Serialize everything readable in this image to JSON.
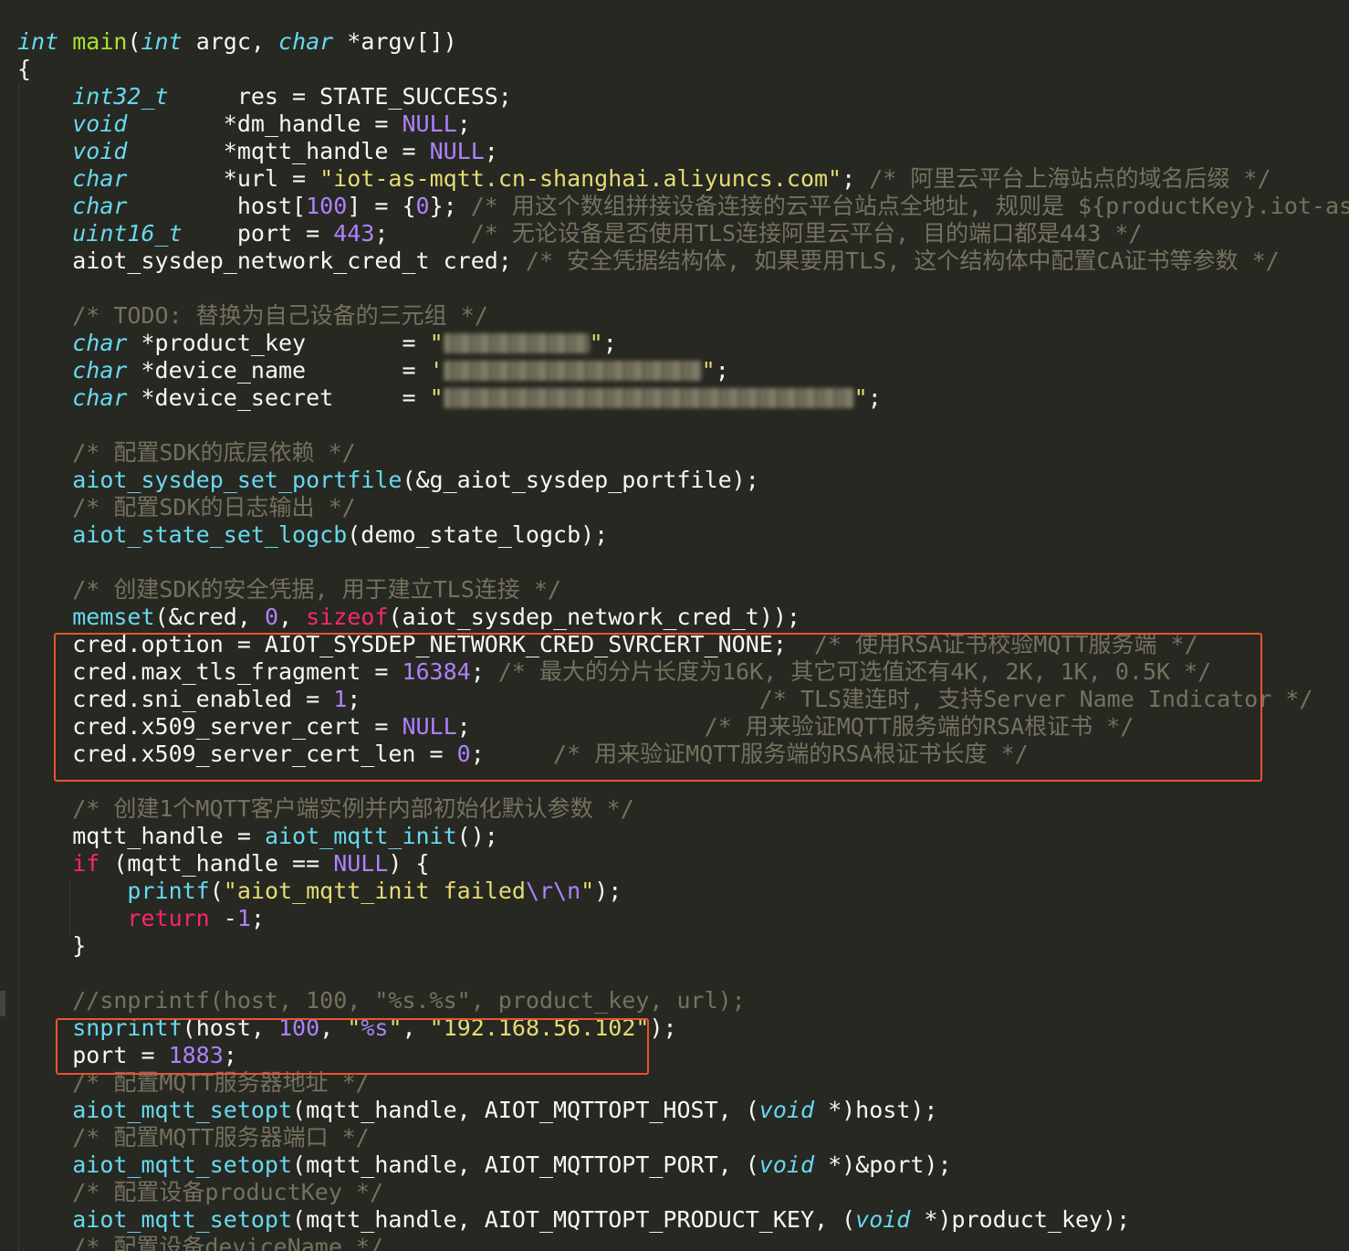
{
  "editor": {
    "colors": {
      "background": "#272822",
      "text": "#f8f8f2",
      "type": "#66d9ef",
      "function": "#a6e22e",
      "keyword": "#f92672",
      "number": "#ae81ff",
      "string": "#e6db74",
      "comment": "#75715e",
      "highlight_box": "#e8542f"
    },
    "lines": [
      [
        {
          "t": "int",
          "c": "type"
        },
        {
          "t": " ",
          "c": "plain"
        },
        {
          "t": "main",
          "c": "defn"
        },
        {
          "t": "(",
          "c": "plain"
        },
        {
          "t": "int",
          "c": "type"
        },
        {
          "t": " argc, ",
          "c": "plain"
        },
        {
          "t": "char",
          "c": "type"
        },
        {
          "t": " *argv[])",
          "c": "plain"
        }
      ],
      [
        {
          "t": "{",
          "c": "plain"
        }
      ],
      [
        {
          "t": "    ",
          "c": "plain"
        },
        {
          "t": "int32_t",
          "c": "type"
        },
        {
          "t": "     res = STATE_SUCCESS;",
          "c": "plain"
        }
      ],
      [
        {
          "t": "    ",
          "c": "plain"
        },
        {
          "t": "void",
          "c": "type"
        },
        {
          "t": "       *dm_handle = ",
          "c": "plain"
        },
        {
          "t": "NULL",
          "c": "const"
        },
        {
          "t": ";",
          "c": "plain"
        }
      ],
      [
        {
          "t": "    ",
          "c": "plain"
        },
        {
          "t": "void",
          "c": "type"
        },
        {
          "t": "       *mqtt_handle = ",
          "c": "plain"
        },
        {
          "t": "NULL",
          "c": "const"
        },
        {
          "t": ";",
          "c": "plain"
        }
      ],
      [
        {
          "t": "    ",
          "c": "plain"
        },
        {
          "t": "char",
          "c": "type"
        },
        {
          "t": "       *url = ",
          "c": "plain"
        },
        {
          "t": "\"iot-as-mqtt.cn-shanghai.aliyuncs.com\"",
          "c": "str"
        },
        {
          "t": "; ",
          "c": "plain"
        },
        {
          "t": "/* 阿里云平台上海站点的域名后缀 */",
          "c": "comment"
        }
      ],
      [
        {
          "t": "    ",
          "c": "plain"
        },
        {
          "t": "char",
          "c": "type"
        },
        {
          "t": "        host[",
          "c": "plain"
        },
        {
          "t": "100",
          "c": "num"
        },
        {
          "t": "] = {",
          "c": "plain"
        },
        {
          "t": "0",
          "c": "num"
        },
        {
          "t": "}; ",
          "c": "plain"
        },
        {
          "t": "/* 用这个数组拼接设备连接的云平台站点全地址, 规则是 ${productKey}.iot-as-mqtt.",
          "c": "comment"
        }
      ],
      [
        {
          "t": "    ",
          "c": "plain"
        },
        {
          "t": "uint16_t",
          "c": "type"
        },
        {
          "t": "    port = ",
          "c": "plain"
        },
        {
          "t": "443",
          "c": "num"
        },
        {
          "t": ";      ",
          "c": "plain"
        },
        {
          "t": "/* 无论设备是否使用TLS连接阿里云平台, 目的端口都是443 */",
          "c": "comment"
        }
      ],
      [
        {
          "t": "    aiot_sysdep_network_cred_t cred; ",
          "c": "plain"
        },
        {
          "t": "/* 安全凭据结构体, 如果要用TLS, 这个结构体中配置CA证书等参数 */",
          "c": "comment"
        }
      ],
      [],
      [
        {
          "t": "    ",
          "c": "plain"
        },
        {
          "t": "/* TODO: 替换为自己设备的三元组 */",
          "c": "comment"
        }
      ],
      [
        {
          "t": "    ",
          "c": "plain"
        },
        {
          "t": "char",
          "c": "type"
        },
        {
          "t": " *product_key       = ",
          "c": "plain"
        },
        {
          "t": "\"",
          "c": "str"
        },
        {
          "t": "",
          "c": "redacted",
          "w": 160
        },
        {
          "t": "\"",
          "c": "str"
        },
        {
          "t": ";",
          "c": "plain"
        }
      ],
      [
        {
          "t": "    ",
          "c": "plain"
        },
        {
          "t": "char",
          "c": "type"
        },
        {
          "t": " *device_name       = ",
          "c": "plain"
        },
        {
          "t": "'",
          "c": "str"
        },
        {
          "t": "",
          "c": "redacted",
          "w": 283
        },
        {
          "t": "\"",
          "c": "str"
        },
        {
          "t": ";",
          "c": "plain"
        }
      ],
      [
        {
          "t": "    ",
          "c": "plain"
        },
        {
          "t": "char",
          "c": "type"
        },
        {
          "t": " *device_secret     = ",
          "c": "plain"
        },
        {
          "t": "\"",
          "c": "str"
        },
        {
          "t": "",
          "c": "redacted",
          "w": 450
        },
        {
          "t": "\"",
          "c": "str"
        },
        {
          "t": ";",
          "c": "plain"
        }
      ],
      [],
      [
        {
          "t": "    ",
          "c": "plain"
        },
        {
          "t": "/* 配置SDK的底层依赖 */",
          "c": "comment"
        }
      ],
      [
        {
          "t": "    ",
          "c": "plain"
        },
        {
          "t": "aiot_sysdep_set_portfile",
          "c": "func"
        },
        {
          "t": "(&g_aiot_sysdep_portfile);",
          "c": "plain"
        }
      ],
      [
        {
          "t": "    ",
          "c": "plain"
        },
        {
          "t": "/* 配置SDK的日志输出 */",
          "c": "comment"
        }
      ],
      [
        {
          "t": "    ",
          "c": "plain"
        },
        {
          "t": "aiot_state_set_logcb",
          "c": "func"
        },
        {
          "t": "(demo_state_logcb);",
          "c": "plain"
        }
      ],
      [],
      [
        {
          "t": "    ",
          "c": "plain"
        },
        {
          "t": "/* 创建SDK的安全凭据, 用于建立TLS连接 */",
          "c": "comment"
        }
      ],
      [
        {
          "t": "    ",
          "c": "plain"
        },
        {
          "t": "memset",
          "c": "func"
        },
        {
          "t": "(&cred, ",
          "c": "plain"
        },
        {
          "t": "0",
          "c": "num"
        },
        {
          "t": ", ",
          "c": "plain"
        },
        {
          "t": "sizeof",
          "c": "kw"
        },
        {
          "t": "(aiot_sysdep_network_cred_t));",
          "c": "plain"
        }
      ],
      [
        {
          "t": "    cred.option = AIOT_SYSDEP_NETWORK_CRED_SVRCERT_NONE;  ",
          "c": "plain"
        },
        {
          "t": "/* 使用RSA证书校验MQTT服务端 */",
          "c": "comment"
        }
      ],
      [
        {
          "t": "    cred.max_tls_fragment = ",
          "c": "plain"
        },
        {
          "t": "16384",
          "c": "num"
        },
        {
          "t": "; ",
          "c": "plain"
        },
        {
          "t": "/* 最大的分片长度为16K, 其它可选值还有4K, 2K, 1K, 0.5K */",
          "c": "comment"
        }
      ],
      [
        {
          "t": "    cred.sni_enabled = ",
          "c": "plain"
        },
        {
          "t": "1",
          "c": "num"
        },
        {
          "t": ";                             ",
          "c": "plain"
        },
        {
          "t": "/* TLS建连时, 支持Server Name Indicator */",
          "c": "comment"
        }
      ],
      [
        {
          "t": "    cred.x509_server_cert = ",
          "c": "plain"
        },
        {
          "t": "NULL",
          "c": "const"
        },
        {
          "t": ";                 ",
          "c": "plain"
        },
        {
          "t": "/* 用来验证MQTT服务端的RSA根证书 */",
          "c": "comment"
        }
      ],
      [
        {
          "t": "    cred.x509_server_cert_len = ",
          "c": "plain"
        },
        {
          "t": "0",
          "c": "num"
        },
        {
          "t": ";     ",
          "c": "plain"
        },
        {
          "t": "/* 用来验证MQTT服务端的RSA根证书长度 */",
          "c": "comment"
        }
      ],
      [],
      [
        {
          "t": "    ",
          "c": "plain"
        },
        {
          "t": "/* 创建1个MQTT客户端实例并内部初始化默认参数 */",
          "c": "comment"
        }
      ],
      [
        {
          "t": "    mqtt_handle = ",
          "c": "plain"
        },
        {
          "t": "aiot_mqtt_init",
          "c": "func"
        },
        {
          "t": "();",
          "c": "plain"
        }
      ],
      [
        {
          "t": "    ",
          "c": "plain"
        },
        {
          "t": "if",
          "c": "kw"
        },
        {
          "t": " (mqtt_handle == ",
          "c": "plain"
        },
        {
          "t": "NULL",
          "c": "const"
        },
        {
          "t": ") {",
          "c": "plain"
        }
      ],
      [
        {
          "t": "        ",
          "c": "plain"
        },
        {
          "t": "printf",
          "c": "func"
        },
        {
          "t": "(",
          "c": "plain"
        },
        {
          "t": "\"aiot_mqtt_init failed",
          "c": "str"
        },
        {
          "t": "\\r\\n",
          "c": "esc"
        },
        {
          "t": "\"",
          "c": "str"
        },
        {
          "t": ");",
          "c": "plain"
        }
      ],
      [
        {
          "t": "        ",
          "c": "plain"
        },
        {
          "t": "return",
          "c": "kw"
        },
        {
          "t": " -",
          "c": "plain"
        },
        {
          "t": "1",
          "c": "num"
        },
        {
          "t": ";",
          "c": "plain"
        }
      ],
      [
        {
          "t": "    }",
          "c": "plain"
        }
      ],
      [],
      [
        {
          "t": "    ",
          "c": "plain"
        },
        {
          "t": "//snprintf(host, 100, \"%s.%s\", product_key, url);",
          "c": "comment"
        }
      ],
      [
        {
          "t": "    ",
          "c": "plain"
        },
        {
          "t": "snprintf",
          "c": "func"
        },
        {
          "t": "(host, ",
          "c": "plain"
        },
        {
          "t": "100",
          "c": "num"
        },
        {
          "t": ", ",
          "c": "plain"
        },
        {
          "t": "\"",
          "c": "str"
        },
        {
          "t": "%s",
          "c": "esc"
        },
        {
          "t": "\"",
          "c": "str"
        },
        {
          "t": ", ",
          "c": "plain"
        },
        {
          "t": "\"192.168.56.102\"",
          "c": "str"
        },
        {
          "t": ");",
          "c": "plain"
        }
      ],
      [
        {
          "t": "    port = ",
          "c": "plain"
        },
        {
          "t": "1883",
          "c": "num"
        },
        {
          "t": ";",
          "c": "plain"
        }
      ],
      [
        {
          "t": "    ",
          "c": "plain"
        },
        {
          "t": "/* 配置MQTT服务器地址 */",
          "c": "comment"
        }
      ],
      [
        {
          "t": "    ",
          "c": "plain"
        },
        {
          "t": "aiot_mqtt_setopt",
          "c": "func"
        },
        {
          "t": "(mqtt_handle, AIOT_MQTTOPT_HOST, (",
          "c": "plain"
        },
        {
          "t": "void",
          "c": "type"
        },
        {
          "t": " *)host);",
          "c": "plain"
        }
      ],
      [
        {
          "t": "    ",
          "c": "plain"
        },
        {
          "t": "/* 配置MQTT服务器端口 */",
          "c": "comment"
        }
      ],
      [
        {
          "t": "    ",
          "c": "plain"
        },
        {
          "t": "aiot_mqtt_setopt",
          "c": "func"
        },
        {
          "t": "(mqtt_handle, AIOT_MQTTOPT_PORT, (",
          "c": "plain"
        },
        {
          "t": "void",
          "c": "type"
        },
        {
          "t": " *)&port);",
          "c": "plain"
        }
      ],
      [
        {
          "t": "    ",
          "c": "plain"
        },
        {
          "t": "/* 配置设备productKey */",
          "c": "comment"
        }
      ],
      [
        {
          "t": "    ",
          "c": "plain"
        },
        {
          "t": "aiot_mqtt_setopt",
          "c": "func"
        },
        {
          "t": "(mqtt_handle, AIOT_MQTTOPT_PRODUCT_KEY, (",
          "c": "plain"
        },
        {
          "t": "void",
          "c": "type"
        },
        {
          "t": " *)product_key);",
          "c": "plain"
        }
      ],
      [
        {
          "t": "    ",
          "c": "plain"
        },
        {
          "t": "/* 配置设备deviceName */",
          "c": "comment"
        }
      ]
    ]
  }
}
